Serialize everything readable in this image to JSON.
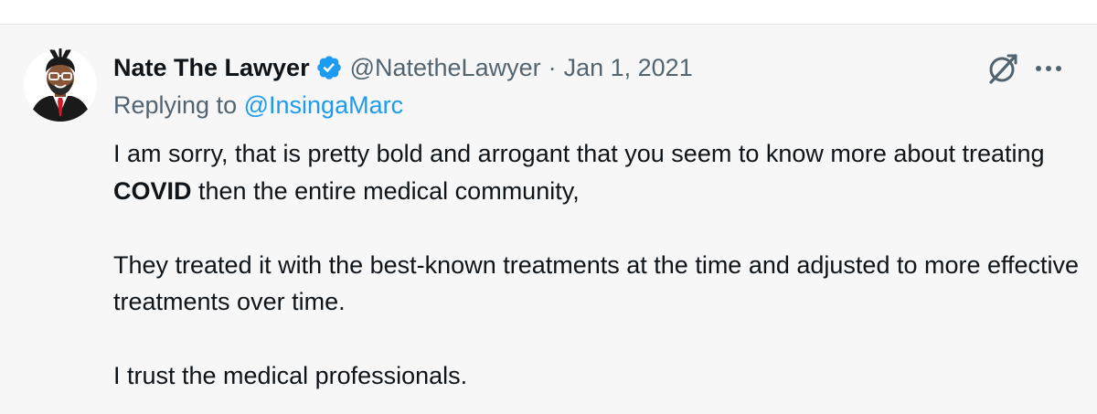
{
  "tweet": {
    "display_name": "Nate The Lawyer",
    "handle": "@NatetheLawyer",
    "separator": "·",
    "date": "Jan 1, 2021",
    "replying_prefix": "Replying to",
    "replying_to": "@InsingaMarc",
    "body": {
      "p1_before": "I am sorry, that is pretty bold and arrogant that you seem to know more about treating ",
      "p1_bold": "COVID",
      "p1_after": " then the entire medical community,",
      "p2": "They treated it with the best-known treatments at the time and adjusted to more effective treatments over time.",
      "p3": "I trust the medical professionals."
    }
  },
  "icons": {
    "verified": "verified-badge-icon",
    "grok": "grok-icon",
    "more": "more-options-icon"
  },
  "colors": {
    "background": "#f7f7f7",
    "text_primary": "#0f1419",
    "text_secondary": "#536471",
    "accent": "#1d9bf0"
  }
}
